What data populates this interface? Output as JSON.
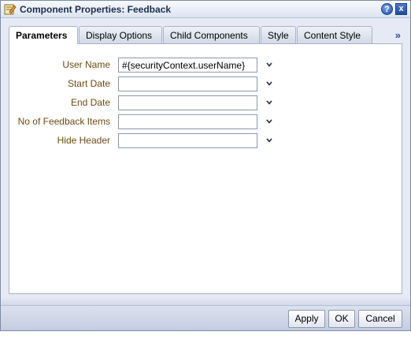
{
  "window": {
    "title": "Component Properties: Feedback",
    "help_icon_text": "?",
    "close_icon_text": "x"
  },
  "tabs": [
    {
      "label": "Parameters",
      "active": true
    },
    {
      "label": "Display Options",
      "active": false
    },
    {
      "label": "Child Components",
      "active": false
    },
    {
      "label": "Style",
      "active": false
    },
    {
      "label": "Content Style",
      "active": false
    }
  ],
  "tabs_overflow": "»",
  "fields": [
    {
      "label": "User Name",
      "value": "#{securityContext.userName}"
    },
    {
      "label": "Start Date",
      "value": ""
    },
    {
      "label": "End Date",
      "value": ""
    },
    {
      "label": "No of Feedback Items",
      "value": ""
    },
    {
      "label": "Hide Header",
      "value": ""
    }
  ],
  "footer": {
    "apply_label": "Apply",
    "ok_label": "OK",
    "cancel_label": "Cancel"
  },
  "colors": {
    "label_text": "#6b4b12",
    "accent": "#1f4fa8"
  }
}
